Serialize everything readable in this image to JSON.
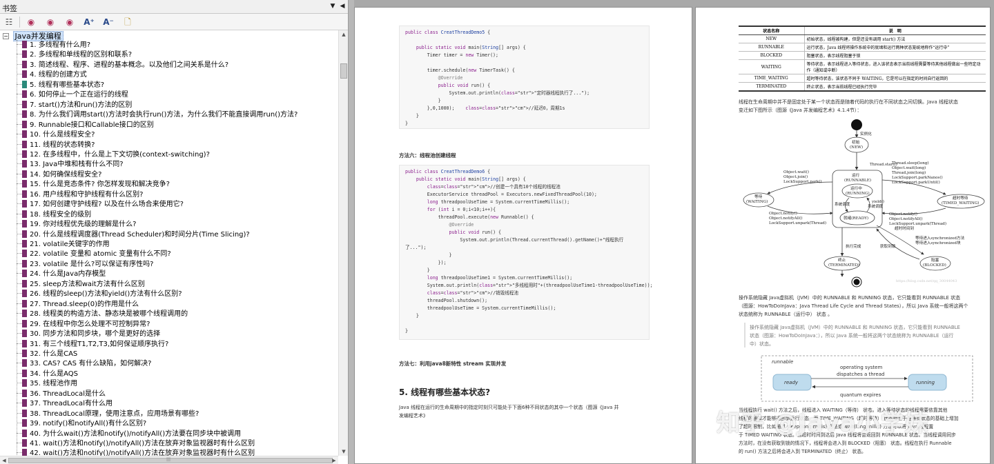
{
  "bookmarks_panel": {
    "title": "书签",
    "pin_glyph": "▼",
    "collapse_glyph": "◀",
    "toolbar": [
      {
        "icon": "options-menu-icon",
        "glyph": "☷"
      },
      {
        "icon": "expand-bookmark-icon",
        "glyph": "◉"
      },
      {
        "icon": "new-bookmark-icon",
        "glyph": "◉"
      },
      {
        "icon": "bookmark-find-icon",
        "glyph": "◉"
      },
      {
        "icon": "font-increase-icon",
        "glyph": "A⁺"
      },
      {
        "icon": "font-decrease-icon",
        "glyph": "A⁻"
      },
      {
        "icon": "page-properties-icon",
        "glyph": "🗋"
      }
    ],
    "root": {
      "expand_glyph": "−",
      "label": "Java并发编程"
    },
    "items": [
      "1. 多线程有什么用?",
      "2. 多线程和单线程的区别和联系?",
      "3. 简述线程、程序、进程的基本概念。以及他们之间关系是什么?",
      "4. 线程的创建方式",
      "5. 线程有哪些基本状态?",
      "6. 如何停止一个正在运行的线程",
      "7. start()方法和run()方法的区别",
      "8. 为什么我们调用start()方法时会执行run()方法，为什么我们不能直接调用run()方法?",
      "9. Runnable接口和Callable接口的区别",
      "10. 什么是线程安全?",
      "11. 线程的状态转换?",
      "12. 在多线程中，什么是上下文切换(context-switching)?",
      "13. Java中堆和栈有什么不同?",
      "14. 如何确保线程安全?",
      "15. 什么是竞态条件? 你怎样发现和解决竞争?",
      "16. 用户线程和守护线程有什么区别?",
      "17. 如何创建守护线程? 以及在什么场合来使用它?",
      "18. 线程安全的级别",
      "19. 你对线程优先级的理解是什么?",
      "20. 什么是线程调度器(Thread Scheduler)和时间分片(Time Slicing)?",
      "21. volatile关键字的作用",
      "22. volatile 变量和 atomic 变量有什么不同?",
      "23. volatile 是什么?可以保证有序性吗?",
      "24. 什么是Java内存模型",
      "25. sleep方法和wait方法有什么区别",
      "26. 线程的sleep()方法和yield()方法有什么区别?",
      "27. Thread.sleep(0)的作用是什么",
      "28. 线程类的构造方法、静态块是被哪个线程调用的",
      "29. 在线程中你怎么处理不可控制异常?",
      "30. 同步方法和同步块，哪个是更好的选择",
      "31. 有三个线程T1,T2,T3,如何保证顺序执行?",
      "32. 什么是CAS",
      "33. CAS? CAS 有什么缺陷，如何解决?",
      "34. 什么是AQS",
      "35. 线程池作用",
      "36. ThreadLocal是什么",
      "37. ThreadLocal有什么用",
      "38. ThreadLocal原理，使用注意点，应用场景有哪些?",
      "39. notify()和notifyAll()有什么区别?",
      "40. 为什么wait()方法和notify()/notifyAll()方法要在同步块中被调用",
      "41. wait()方法和notify()/notifyAll()方法在放弃对象监视器时有什么区别",
      "42. wait()方法和notify()/notifyAll()方法在放弃对象监视器时有什么区别"
    ],
    "current_item_index": 4,
    "scroll": {
      "up": "▲",
      "down": "▼",
      "left": "◀",
      "right": "▶",
      "grip": "|||"
    }
  },
  "left_page": {
    "code1": [
      "public class CreatThreadDemo5 {",
      "",
      "    public static void main(String[] args) {",
      "        Timer timer = new Timer();",
      "",
      "        timer.schedule(new TimerTask() {",
      "            @Override",
      "            public void run() {",
      "                System.out.println(\"定时器线程执行了...\");",
      "            }",
      "        },0,1000);    //延迟0，周期1s",
      "    }",
      "}"
    ],
    "method6_title": "方法六：线程池创建线程",
    "code2": [
      "public class CreatThreadDemo6 {",
      "    public static void main(String[] args) {",
      "        //创建一个具有10个线程的线程池",
      "        ExecutorService threadPool = Executors.newFixedThreadPool(10);",
      "        long threadpoolUseTime = System.currentTimeMillis();",
      "        for (int i = 0;i<10;i++){",
      "            threadPool.execute(new Runnable() {",
      "                @Override",
      "                public void run() {",
      "                    System.out.println(Thread.currentThread().getName()+\"线程执行",
      "了...\");",
      "                }",
      "            });",
      "        }",
      "        long threadpoolUseTime1 = System.currentTimeMillis();",
      "        System.out.println(\"多线程用时\"+(threadpoolUseTime1-threadpoolUseTime));",
      "        //销毁线程池",
      "        threadPool.shutdown();",
      "        threadpoolUseTime = System.currentTimeMillis();",
      "    }",
      "",
      "}"
    ],
    "method7_title": "方法七：利用java8新特性 stream 实现并发",
    "section_heading": "5. 线程有哪些基本状态?",
    "section_text": [
      "Java 线程在运行的生命周期中的指定时刻只可能处于下面6种不同状态的其中一个状态（图源《Java 并",
      "发编程艺术》"
    ]
  },
  "right_page": {
    "table_headers": [
      "状态名称",
      "说　明"
    ],
    "table_rows": [
      [
        "NEW",
        "初始状态，线程被构建，但是还没有调用 start() 方法"
      ],
      [
        "RUNNABLE",
        "运行状态，Java 线程将操作系统中的就绪和运行两种状态笼统地称作“运行中”"
      ],
      [
        "BLOCKED",
        "阻塞状态，表示线程阻塞于锁"
      ],
      [
        "WAITING",
        "等待状态，表示线程进入等待状态，进入该状态表示当前线程需要等待其他线程做出一些特定动作（通知或中断）"
      ],
      [
        "TIME_WAITING",
        "超时等待状态，该状态不同于 WAITING，它是可以在指定的时间自行返回的"
      ],
      [
        "TERMINATED",
        "终止状态，表示当前线程已经执行完毕"
      ]
    ],
    "intro_text": [
      "线程在生命周期中并不是固定处于某一个状态而是随着代码的执行在不同状态之间切换。Java 线程状态",
      "变迁如下图所示（图源《Java 并发编程艺术》4.1.4节）："
    ],
    "diagram": {
      "instantiate": "实例化",
      "new_state": [
        "初始",
        "(NEW)"
      ],
      "thread_start": "Thread.start()",
      "runnable_state": [
        "运行",
        "(RUNNABLE)"
      ],
      "running_state": [
        "运行中",
        "(RUNNING)"
      ],
      "ready_state": "就绪(READY)",
      "os_schedule": "系统调度",
      "yield": [
        "yield()",
        "系统调度"
      ],
      "waiting_state": [
        "等待",
        "(WAITING)"
      ],
      "timed_waiting_state": [
        "超时等待",
        "(TIMED_WAITING)"
      ],
      "to_waiting": [
        "Object.wait()",
        "Object.join()",
        "LockSupport.park()"
      ],
      "from_waiting": [
        "Object.notify()",
        "Object.notifyAll()",
        "LockSupport.unpark(Thread)"
      ],
      "to_timed": [
        "Thread.sleep(long)",
        "Object.wait(long)",
        "Thread.join(long)",
        "LockSupport.parkNanos()",
        "LockSupport.parkUntil()"
      ],
      "from_timed": [
        "Object.notify()",
        "Object.notifyAll()",
        "LockSupport.unpark(Thread)",
        "超时时间到"
      ],
      "to_blocked": [
        "等待进入synchronized方法",
        "等待进入synchronized块"
      ],
      "from_blocked": "获取到锁",
      "exec_done": "执行完成",
      "terminated_state": [
        "终止",
        "(TERMINATED)"
      ],
      "blocked_state": [
        "阻塞",
        "(BLOCKED)"
      ],
      "watermark_url": "https://blog.csdn.net/qq_30044043"
    },
    "para1": [
      "操作系统隐藏 Java虚拟机（JVM）中的 RUNNABLE 和 RUNNING 状态，它只能看到 RUNNABLE 状态",
      "（图源：HowToDoInJava：Java Thread Life Cycle and Thread States），所以 Java 系统一般将这两个",
      "状态统称为 RUNNABLE（运行中） 状态 。"
    ],
    "quote": [
      "操作系统隐藏 Java虚拟机（JVM）中的 RUNNABLE 和 RUNNING 状态，它只能看到 RUNNABLE",
      "状态（图源：HowToDoInJava：），所以 Java 系统一般将这两个状态统称为 RUNNABLE（运行",
      "中）状态。"
    ],
    "runnable_diagram": {
      "label": "runnable",
      "ready": "ready",
      "running": "running",
      "dispatch": [
        "operating system",
        "dispatches a thread"
      ],
      "expire": "quantum expires"
    },
    "para2": [
      "当线程执行 wait() 方法之后，线程进入 WAITING（等待） 状态。进入等待状态的线程需要依靠其他",
      "线程的通知才能够返回到运行状态，而 TIME_WAITING（超时等待） 状态相当于在等待状态的基础上增加",
      "了超时限制，比如通过 sleep(long millis) 方法或 wait(long millis) 方法可以将 Java 线程置",
      "于 TIMED WAITING 状态。当超时时间到达后 Java 线程将会返回到 RUNNABLE 状态。当线程调用同步",
      "方法时，在没有获取到锁的情况下，线程将会进入到 BLOCKED（阻塞） 状态。线程在执行 Runnable",
      "的 run() 方法之后将会进入到 TERMINATED（终止） 状态。"
    ],
    "watermark": "知乎 @Java小学妹"
  },
  "colors": {
    "bookmark_icon": "#7a2c6b",
    "current_bookmark_icon": "#2b8a7a",
    "code_keyword": "#8a1d8c",
    "code_comment": "#b8262b"
  }
}
